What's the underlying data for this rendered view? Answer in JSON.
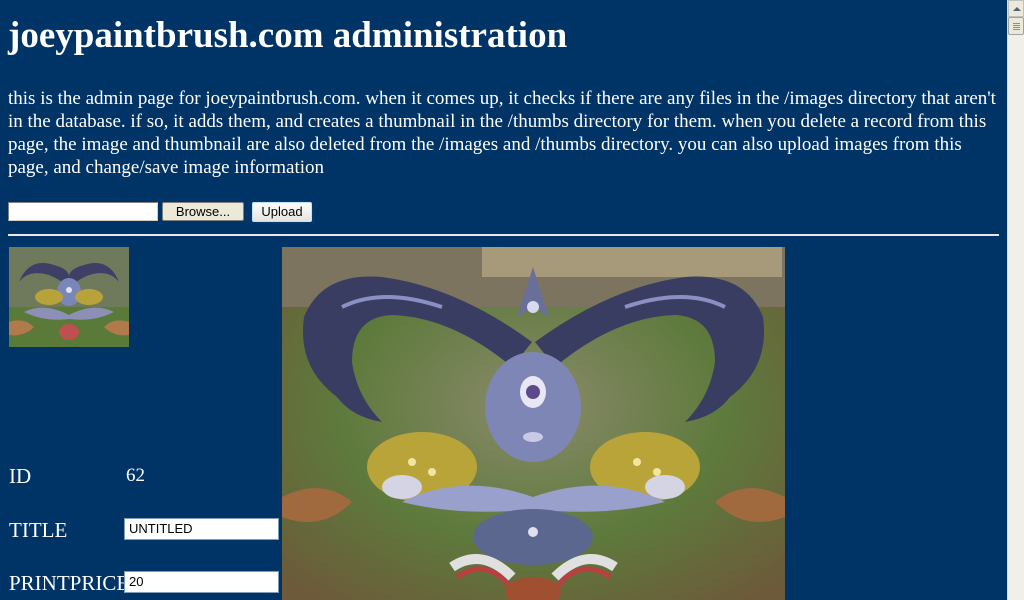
{
  "page": {
    "title": "joeypaintbrush.com administration",
    "intro": "this is the admin page for joeypaintbrush.com. when it comes up, it checks if there are any files in the /images directory that aren't in the database. if so, it adds them, and creates a thumbnail in the /thumbs directory for them. when you delete a record from this page, the image and thumbnail are also deleted from the /images and /thumbs directory. you can also upload images from this page, and change/save image information"
  },
  "upload": {
    "file_value": "",
    "browse_label": "Browse...",
    "upload_label": "Upload"
  },
  "record": {
    "id_label": "ID",
    "id_value": "62",
    "title_label": "TITLE",
    "title_value": "UNTITLED",
    "printprice_label": "PRINTPRICE",
    "printprice_value": "20"
  },
  "colors": {
    "background": "#003366",
    "text": "#ffffff"
  }
}
